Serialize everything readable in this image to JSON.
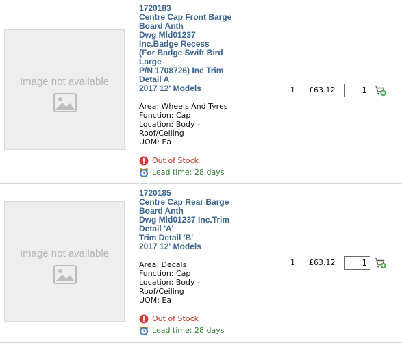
{
  "products": [
    {
      "code": "1720183",
      "title_lines": [
        "Centre Cap Front Barge",
        "Board Anth",
        "Dwg Mld01237",
        "Inc.Badge Recess",
        "(For Badge Swift Bird",
        "Large",
        "P/N 1708726) Inc Trim",
        "Detail A",
        "2017 12' Models"
      ],
      "attributes": [
        "Area: Wheels And Tyres",
        "Function: Cap",
        "Location: Body -",
        "Roof/Ceiling",
        "UOM: Ea"
      ],
      "image_placeholder": "Image not available",
      "stock_status": "Out of Stock",
      "lead_time": "Lead time: 28 days",
      "quantity_label": "1",
      "price": "£63.12",
      "quantity_value": "1"
    },
    {
      "code": "1720185",
      "title_lines": [
        "Centre Cap Rear Barge",
        "Board Anth",
        "Dwg Mld01237 Inc.Trim",
        "Detail 'A'",
        "Trim Detail 'B'",
        "2017 12' Models"
      ],
      "attributes": [
        "Area: Decals",
        "Function: Cap",
        "Location: Body -",
        "Roof/Ceiling",
        "UOM: Ea"
      ],
      "image_placeholder": "Image not available",
      "stock_status": "Out of Stock",
      "lead_time": "Lead time: 28 days",
      "quantity_label": "1",
      "price": "£63.12",
      "quantity_value": "1"
    }
  ],
  "icons": {
    "placeholder": "image-icon",
    "stock_status": "warning-icon",
    "lead_time": "alarm-clock-icon",
    "add_to_cart": "add-to-cart-icon"
  },
  "colors": {
    "title": "#3b6592",
    "out_of_stock": "#c0392b",
    "lead_time": "#2e7d32",
    "divider": "#d6d6d6"
  }
}
